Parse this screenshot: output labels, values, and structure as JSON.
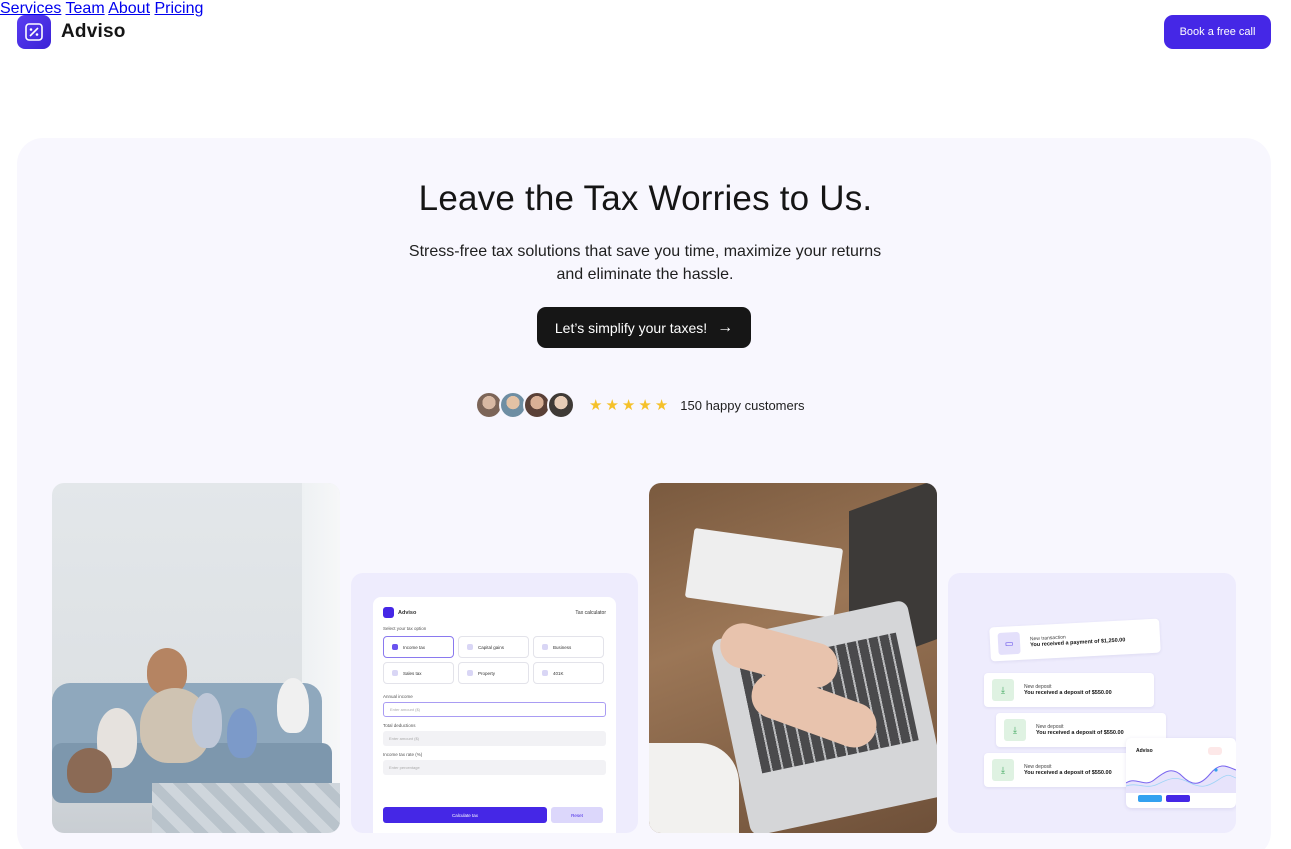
{
  "brand": {
    "name": "Adviso"
  },
  "nav": {
    "items": [
      {
        "label": "Services"
      },
      {
        "label": "Team"
      },
      {
        "label": "About"
      },
      {
        "label": "Pricing"
      }
    ],
    "cta_label": "Book a free call"
  },
  "hero": {
    "title": "Leave the Tax Worries to Us.",
    "subtitle": "Stress-free tax solutions that save you time, maximize your returns and eliminate the hassle.",
    "cta_label": "Let’s simplify your taxes!",
    "rating": 5,
    "customers_text": "150 happy customers"
  },
  "calculator": {
    "brand": "Adviso",
    "title": "Tax calculator",
    "select_label": "Select your tax option",
    "options": [
      "Income tax",
      "Capital gains",
      "Business",
      "Sales tax",
      "Property",
      "401K"
    ],
    "annual_income_label": "Annual income",
    "annual_income_placeholder": "Enter amount ($)",
    "total_deductions_label": "Total deductions",
    "total_deductions_placeholder": "Enter amount ($)",
    "tax_rate_label": "Income tax rate (%)",
    "tax_rate_placeholder": "Enter percentage",
    "calculate_label": "Calculate tax",
    "reset_label": "Reset"
  },
  "deposits": {
    "items": [
      {
        "title": "New transaction",
        "desc": "You received a payment of $1,250.00"
      },
      {
        "title": "New deposit",
        "desc": "You received a deposit of $550.00"
      },
      {
        "title": "New deposit",
        "desc": "You received a deposit of $550.00"
      },
      {
        "title": "New deposit",
        "desc": "You received a deposit of $550.00"
      }
    ],
    "mini_chart": {
      "brand": "Adviso"
    }
  },
  "colors": {
    "accent": "#4527e6",
    "hero_bg": "#f8f7fe",
    "star": "#f5c12a",
    "dark_button": "#161616"
  }
}
